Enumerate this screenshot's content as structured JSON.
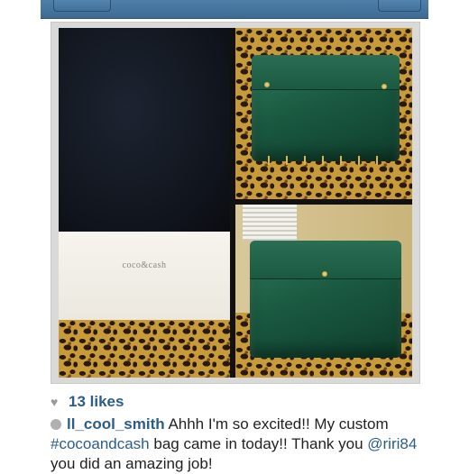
{
  "post": {
    "likes": "13 likes",
    "username": "ll_cool_smith",
    "caption_pre": "Ahhh I'm so excited!! My custom ",
    "hashtag": "#cocoandcash",
    "caption_mid": " bag came in today!! Thank you ",
    "mention": "@riri84",
    "caption_post": " you did an amazing job!"
  },
  "photo": {
    "box_brand": "coco&cash"
  },
  "icons": {
    "likes": "heart-icon",
    "comment": "comment-bubble-icon"
  },
  "colors": {
    "link_blue": "#2a5d8a",
    "bag_green": "#1a5a41",
    "nav_blue": "#3c6a93"
  }
}
